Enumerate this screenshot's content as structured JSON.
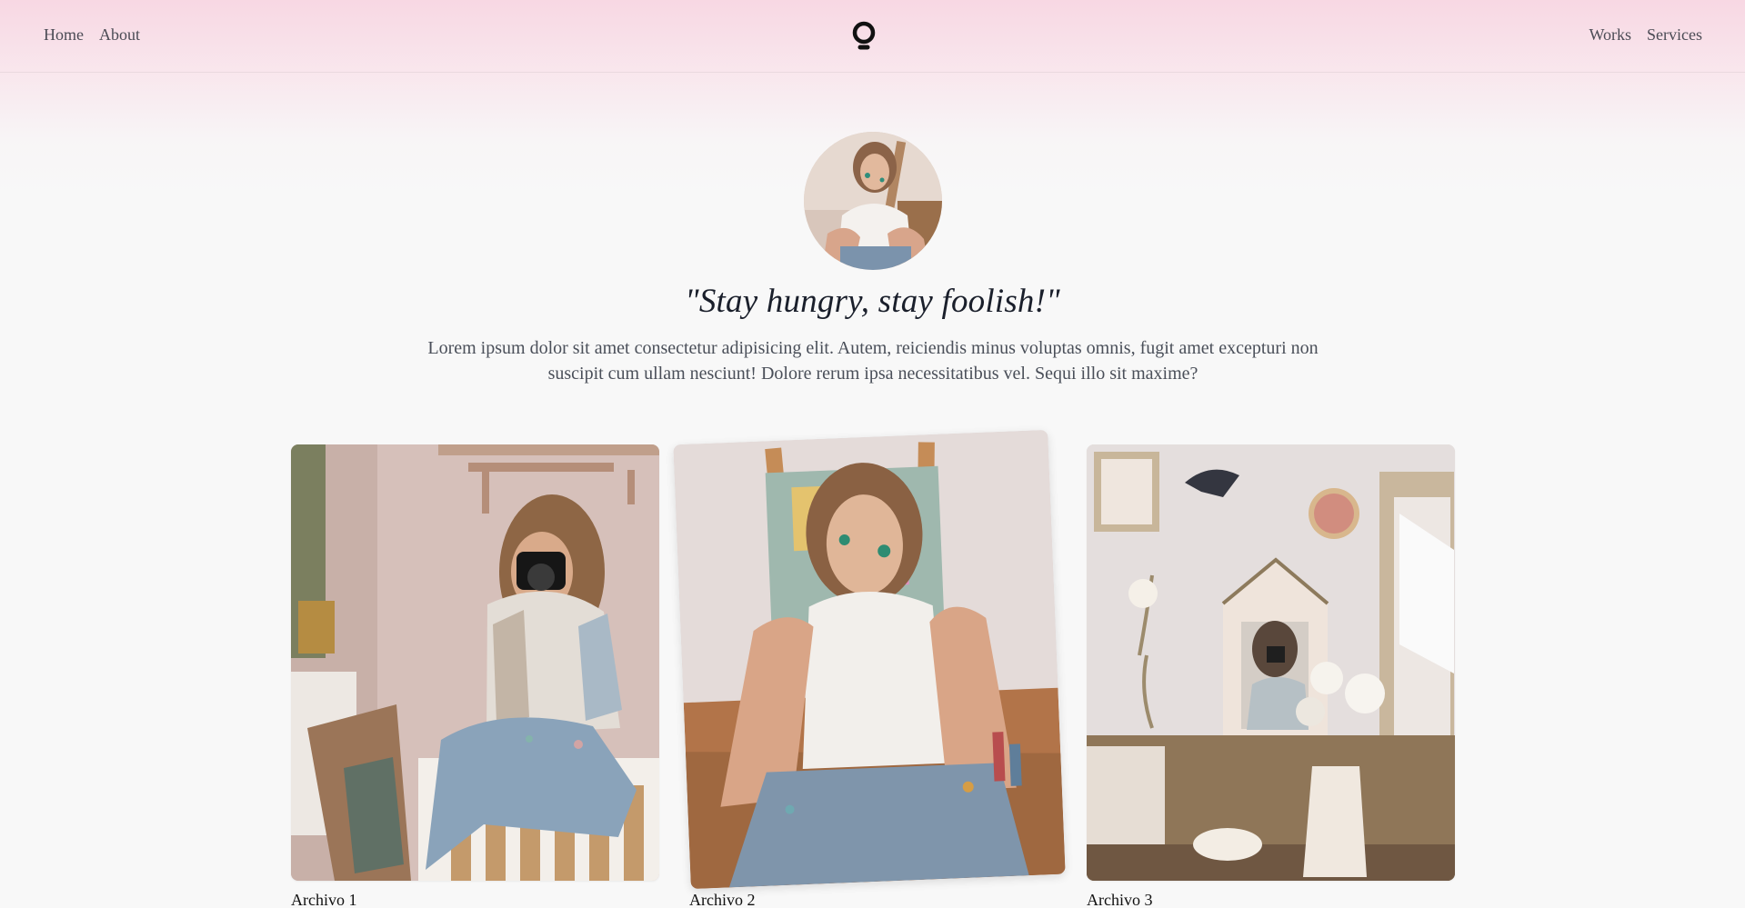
{
  "nav": {
    "left": [
      {
        "label": "Home"
      },
      {
        "label": "About"
      }
    ],
    "right": [
      {
        "label": "Works"
      },
      {
        "label": "Services"
      }
    ],
    "logo_icon": "ring-logo-icon"
  },
  "hero": {
    "avatar_icon": "profile-photo",
    "quote": "\"Stay hungry, stay foolish!\"",
    "intro": "Lorem ipsum dolor sit amet consectetur adipisicing elit. Autem, reiciendis minus voluptas omnis, fugit amet excepturi non suscipit cum ullam nesciunt! Dolore rerum ipsa necessitatibus vel. Sequi illo sit maxime?"
  },
  "gallery": [
    {
      "caption": "Archivo 1",
      "image": "woman-with-camera-photo"
    },
    {
      "caption": "Archivo 2",
      "image": "painter-in-tank-top-photo"
    },
    {
      "caption": "Archivo 3",
      "image": "mirror-selfie-photo"
    }
  ],
  "colors": {
    "background": "#f8f8f8",
    "header_tint": "#f8d6e2",
    "text": "#1f2937"
  }
}
